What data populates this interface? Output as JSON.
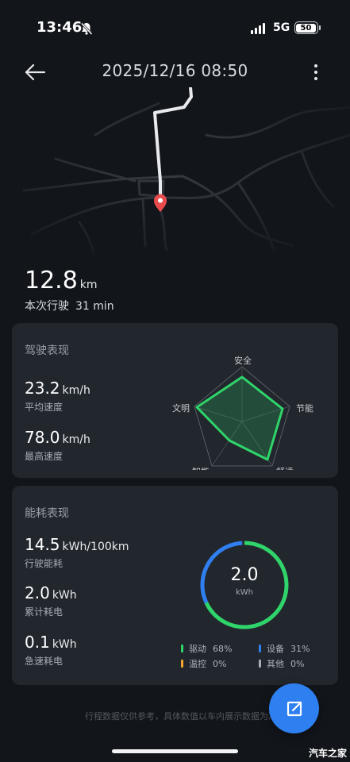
{
  "status": {
    "time": "13:46",
    "network": "5G",
    "battery": "50"
  },
  "header": {
    "title": "2025/12/16 08:50"
  },
  "trip": {
    "distance_value": "12.8",
    "distance_unit": "km",
    "trip_label": "本次行驶",
    "duration": "31 min"
  },
  "driving": {
    "title": "驾驶表现",
    "avg_speed": {
      "value": "23.2",
      "unit": "km/h",
      "label": "平均速度"
    },
    "max_speed": {
      "value": "78.0",
      "unit": "km/h",
      "label": "最高速度"
    },
    "radar_labels": [
      "安全",
      "节能",
      "舒适",
      "智能",
      "文明"
    ]
  },
  "energy": {
    "title": "能耗表现",
    "consumption": {
      "value": "14.5",
      "unit": "kWh/100km",
      "label": "行驶能耗"
    },
    "total": {
      "value": "2.0",
      "unit": "kWh",
      "label": "累计耗电"
    },
    "rapid": {
      "value": "0.1",
      "unit": "kWh",
      "label": "急速耗电"
    },
    "ring_value": "2.0",
    "ring_unit": "kWh",
    "legend": [
      {
        "label": "驱动",
        "pct": "68%",
        "color": "#2fd46a"
      },
      {
        "label": "设备",
        "pct": "31%",
        "color": "#2f7ff0"
      },
      {
        "label": "温控",
        "pct": "0%",
        "color": "#f0a92a"
      },
      {
        "label": "其他",
        "pct": "0%",
        "color": "#a7aeb8"
      }
    ]
  },
  "footer": {
    "disclaimer": "行程数据仅供参考，具体数值以车内展示数据为准"
  },
  "watermark": "汽车之家",
  "colors": {
    "accent_green": "#2fd46a",
    "accent_blue": "#2f7ff0",
    "background": "#12151a",
    "card": "#22262d",
    "pin": "#e84b4b"
  },
  "icons": [
    "bell-off-icon",
    "signal-icon",
    "battery-icon",
    "back-arrow-icon",
    "more-vertical-icon",
    "map-pin-icon",
    "share-icon"
  ]
}
